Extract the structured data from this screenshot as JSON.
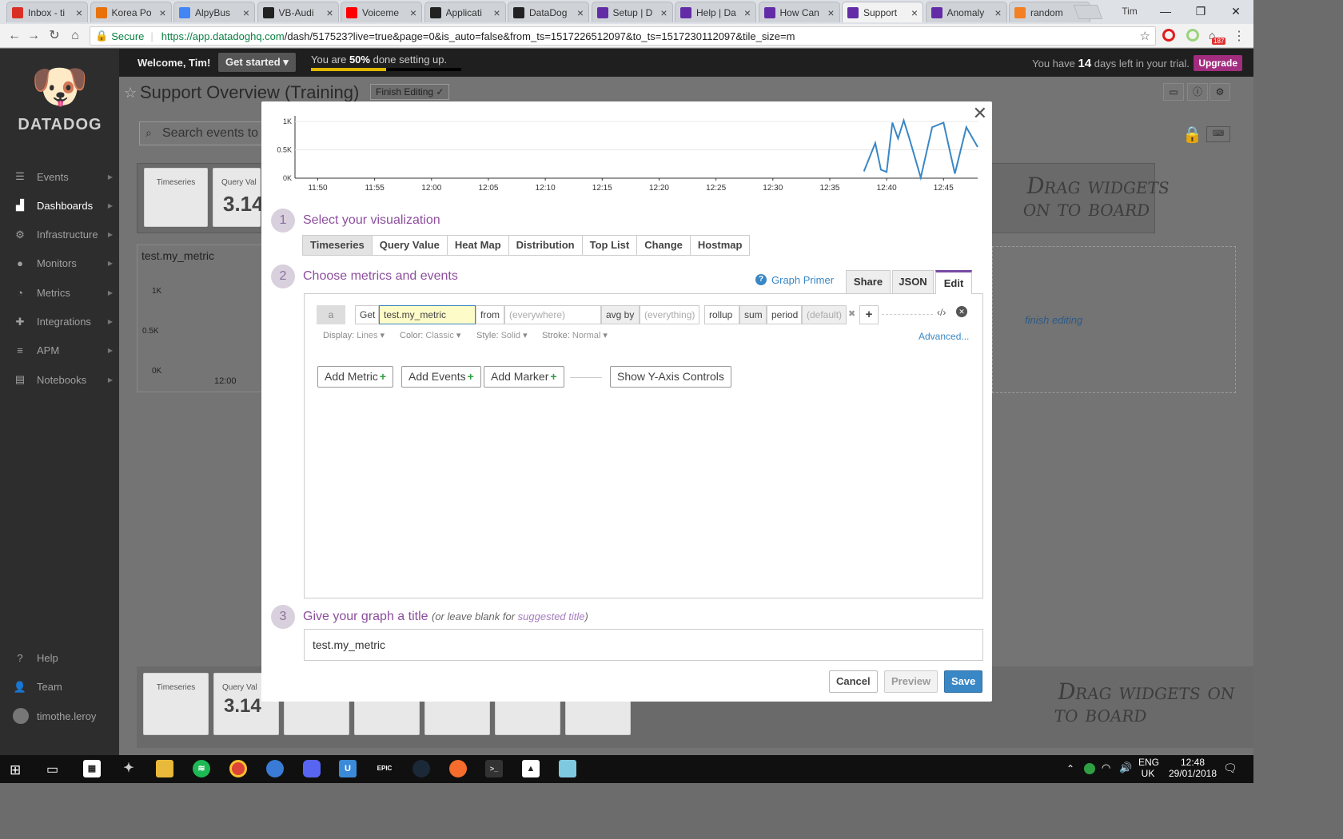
{
  "browser": {
    "tabs": [
      {
        "title": "Inbox - ti",
        "icon": "gmail-icon",
        "color": "#d93025"
      },
      {
        "title": "Korea Po",
        "icon": "orange-circle-icon",
        "color": "#e8710a"
      },
      {
        "title": "AlpyBus",
        "icon": "globe-icon",
        "color": "#4285f4"
      },
      {
        "title": "VB-Audi",
        "icon": "vb-icon",
        "color": "#222222"
      },
      {
        "title": "Voiceme",
        "icon": "youtube-icon",
        "color": "#ff0000"
      },
      {
        "title": "Applicati",
        "icon": "github-icon",
        "color": "#222222"
      },
      {
        "title": "DataDog",
        "icon": "github-icon",
        "color": "#222222"
      },
      {
        "title": "Setup | D",
        "icon": "datadog-icon",
        "color": "#632ca6"
      },
      {
        "title": "Help | Da",
        "icon": "datadog-icon",
        "color": "#632ca6"
      },
      {
        "title": "How Can",
        "icon": "datadog-icon",
        "color": "#632ca6"
      },
      {
        "title": "Support",
        "icon": "datadog-icon",
        "color": "#632ca6",
        "active": true
      },
      {
        "title": "Anomaly",
        "icon": "datadog-icon",
        "color": "#632ca6"
      },
      {
        "title": "random",
        "icon": "stackoverflow-icon",
        "color": "#f48024"
      }
    ],
    "profile_name": "Tim",
    "secure_label": "Secure",
    "url_host": "https://app.datadoghq.com",
    "url_path": "/dash/517523?live=true&page=0&is_auto=false&from_ts=1517226512097&to_ts=1517230112097&tile_size=m",
    "ext_badge": "187"
  },
  "sidebar": {
    "logo_text": "DATADOG",
    "items": [
      {
        "label": "Events",
        "icon": "events-icon",
        "glyph": "☰"
      },
      {
        "label": "Dashboards",
        "icon": "dashboards-icon",
        "glyph": "▟",
        "active": true
      },
      {
        "label": "Infrastructure",
        "icon": "infrastructure-icon",
        "glyph": "⚙"
      },
      {
        "label": "Monitors",
        "icon": "monitors-icon",
        "glyph": "●"
      },
      {
        "label": "Metrics",
        "icon": "metrics-icon",
        "glyph": "◔"
      },
      {
        "label": "Integrations",
        "icon": "integrations-icon",
        "glyph": "✚"
      },
      {
        "label": "APM",
        "icon": "apm-icon",
        "glyph": "≡"
      },
      {
        "label": "Notebooks",
        "icon": "notebooks-icon",
        "glyph": "▤"
      }
    ],
    "bottom": [
      {
        "label": "Help",
        "icon": "help-icon",
        "glyph": "?"
      },
      {
        "label": "Team",
        "icon": "team-icon",
        "glyph": "👤"
      },
      {
        "label": "timothe.leroy",
        "icon": "avatar",
        "glyph": "●"
      }
    ]
  },
  "topband": {
    "welcome": "Welcome, Tim!",
    "get_started": "Get started ▾",
    "setup_prefix": "You are ",
    "setup_pct": "50%",
    "setup_suffix": " done setting up.",
    "setup_progress": 0.5,
    "trial_prefix": "You have ",
    "trial_days": "14",
    "trial_suffix": " days left in your trial.",
    "upgrade": "Upgrade"
  },
  "dashboard": {
    "title": "Support Overview (Training)",
    "finish_editing": "Finish Editing ✓",
    "search_placeholder": "Search events to",
    "drag_hint": "Drag widgets on to board",
    "widget_timeseries": "Timeseries",
    "widget_query_value": "Query Val",
    "query_value_number": "3.14",
    "bg_metric_title": "test.my_metric",
    "bg_yticks": [
      "1K",
      "0.5K",
      "0K"
    ],
    "bg_xtick": "12:00",
    "finish_editing_link": "finish editing"
  },
  "modal": {
    "preview_chart": {
      "yticks": [
        "1K",
        "0.5K",
        "0K"
      ],
      "xticks": [
        "11:50",
        "11:55",
        "12:00",
        "12:05",
        "12:10",
        "12:15",
        "12:20",
        "12:25",
        "12:30",
        "12:35",
        "12:40",
        "12:45"
      ]
    },
    "step1": {
      "num": "1",
      "title": "Select your visualization"
    },
    "viz_tabs": [
      "Timeseries",
      "Query Value",
      "Heat Map",
      "Distribution",
      "Top List",
      "Change",
      "Hostmap"
    ],
    "step2": {
      "num": "2",
      "title": "Choose metrics and events"
    },
    "graph_primer": "Graph Primer",
    "query_tabs": [
      "Share",
      "JSON",
      "Edit"
    ],
    "query": {
      "letter": "a",
      "get": "Get",
      "metric": "test.my_metric",
      "from": "from",
      "from_val": "(everywhere)",
      "avg_by": "avg by",
      "avg_val": "(everything)",
      "rollup": "rollup",
      "rollup_val": "sum",
      "period": "period",
      "period_val": "(default)",
      "add": "+"
    },
    "display": {
      "display_label": "Display:",
      "display_val": "Lines",
      "color_label": "Color:",
      "color_val": "Classic",
      "style_label": "Style:",
      "style_val": "Solid",
      "stroke_label": "Stroke:",
      "stroke_val": "Normal"
    },
    "advanced": "Advanced...",
    "buttons": {
      "add_metric": "Add Metric",
      "add_events": "Add Events",
      "add_marker": "Add Marker",
      "show_y": "Show Y-Axis Controls"
    },
    "step3": {
      "num": "3",
      "title": "Give your graph a title",
      "hint_prefix": "(or leave blank for ",
      "hint_link": "suggested title",
      "hint_suffix": ")"
    },
    "title_value": "test.my_metric",
    "cancel": "Cancel",
    "preview": "Preview",
    "save": "Save"
  },
  "taskbar": {
    "lang": "ENG",
    "region": "UK",
    "time": "12:48",
    "date": "29/01/2018"
  },
  "chart_data": {
    "type": "line",
    "x": [
      "12:38",
      "12:39",
      "12:39:30",
      "12:40",
      "12:40:30",
      "12:41",
      "12:41:30",
      "12:42",
      "12:43",
      "12:44",
      "12:45",
      "12:46",
      "12:47",
      "12:48"
    ],
    "values": [
      120,
      620,
      150,
      110,
      980,
      700,
      1020,
      700,
      10,
      900,
      980,
      80,
      900,
      550
    ],
    "ylim": [
      0,
      1100
    ],
    "xlim": [
      "11:48",
      "12:48"
    ],
    "yticks": [
      "1K",
      "0.5K",
      "0K"
    ],
    "color": "#3a87c5"
  }
}
